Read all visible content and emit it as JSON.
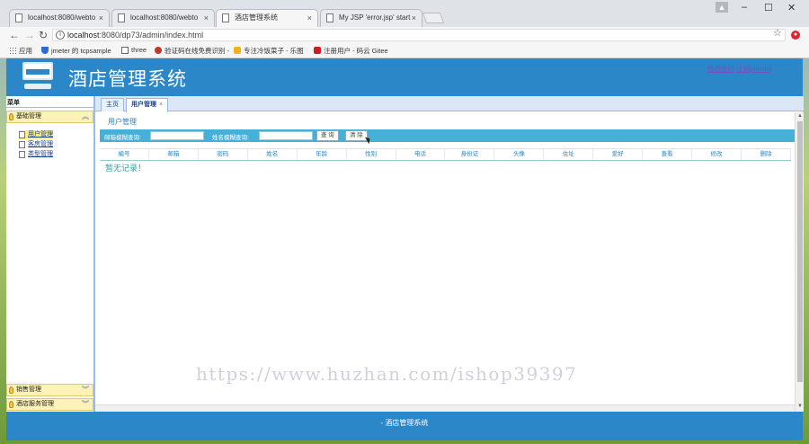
{
  "browser": {
    "tabs": [
      {
        "label": "localhost:8080/webto",
        "active": false
      },
      {
        "label": "localhost:8080/webto",
        "active": false
      },
      {
        "label": "酒店管理系统",
        "active": true
      },
      {
        "label": "My JSP 'error.jsp' start",
        "active": false
      }
    ],
    "url_host": "localhost",
    "url_rest": ":8080/dp73/admin/index.html",
    "bookmarks": [
      {
        "label": "应用",
        "icon": "apps-grid-icon"
      },
      {
        "label": "jmeter 的 tcpsample",
        "icon": "shield-icon"
      },
      {
        "label": "three",
        "icon": "page-icon"
      },
      {
        "label": "验证码在线免费识别 -",
        "icon": "gear-icon"
      },
      {
        "label": "专注冷饭菜子 - 乐图",
        "icon": "hand-icon"
      },
      {
        "label": "注册用户 - 码云 Gitee",
        "icon": "gitee-icon"
      }
    ]
  },
  "app": {
    "title": "酒店管理系统",
    "top_links": {
      "left": "修改密码",
      "right": "注销[admin]"
    },
    "sidebar": {
      "title": "菜单",
      "groups": [
        {
          "label": "基础管理",
          "expanded": true,
          "chevron": "︽",
          "items": [
            {
              "label": "用户管理",
              "selected": true
            },
            {
              "label": "客房管理",
              "selected": false
            },
            {
              "label": "类型管理",
              "selected": false
            }
          ]
        },
        {
          "label": "销售管理",
          "expanded": false,
          "chevron": "︾"
        },
        {
          "label": "酒店服务管理",
          "expanded": false,
          "chevron": "︾"
        }
      ]
    },
    "content_tabs": [
      {
        "label": "主页",
        "active": false
      },
      {
        "label": "用户管理",
        "active": true,
        "close": "×"
      }
    ],
    "section_title": "用户管理",
    "search": {
      "label1": "邮箱模糊查询:",
      "label2": "姓名模糊查询:",
      "query_button": "查 询",
      "clear_button": "清 除"
    },
    "table": {
      "columns": [
        "编号",
        "邮箱",
        "密码",
        "姓名",
        "年龄",
        "性别",
        "电话",
        "身份证",
        "头像",
        "住址",
        "爱好",
        "查看",
        "修改",
        "删除"
      ],
      "empty_message": "暂无记录！"
    },
    "footer": "- 酒店管理系统"
  },
  "watermark": "https://www.huzhan.com/ishop39397",
  "colors": {
    "header": "#2b87c7",
    "search_bar": "#45b0d8",
    "accordion": "#fff2b8"
  }
}
